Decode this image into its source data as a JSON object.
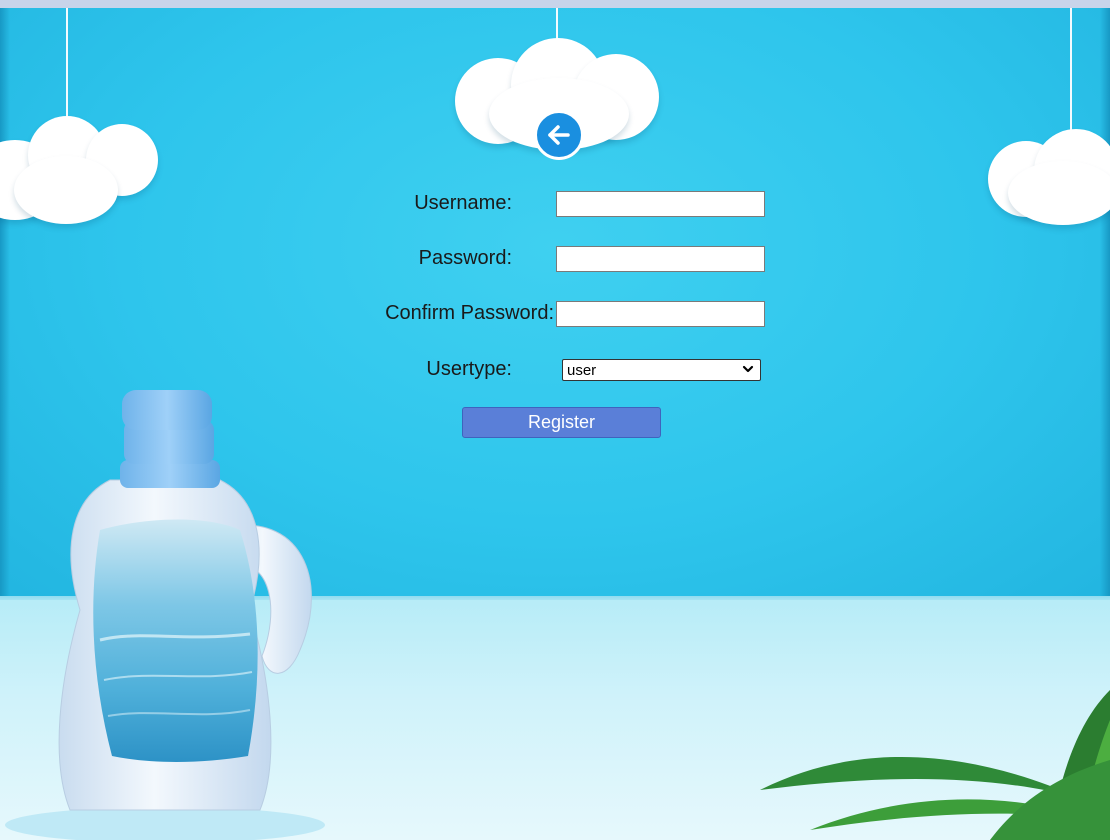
{
  "form": {
    "username_label": "Username:",
    "username_value": "",
    "password_label": "Password:",
    "password_value": "",
    "confirm_password_label": "Confirm Password:",
    "confirm_password_value": "",
    "usertype_label": "Usertype:",
    "usertype_selected": "user",
    "register_label": "Register"
  },
  "icons": {
    "back": "arrow-left-icon",
    "dropdown": "chevron-down-icon"
  },
  "colors": {
    "wall": "#2ec5ec",
    "register_button": "#5a7fd8",
    "back_button": "#1a8fe0"
  }
}
